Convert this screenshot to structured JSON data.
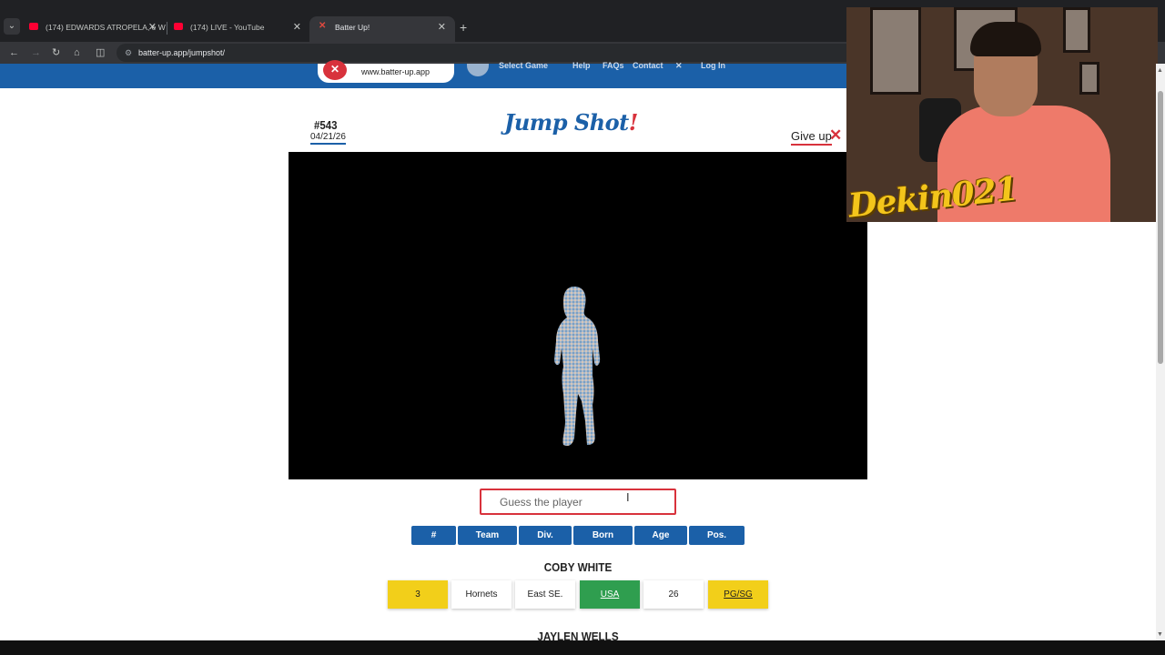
{
  "browser": {
    "tabs": [
      {
        "label": "(174) EDWARDS ATROPELA, e W",
        "favicon": "youtube-icon"
      },
      {
        "label": "(174) LIVE - YouTube",
        "favicon": "youtube-icon"
      },
      {
        "label": "Batter Up!",
        "favicon": "batter-up-icon"
      }
    ],
    "close_glyph": "✕",
    "new_tab_glyph": "+",
    "url": "batter-up.app/jumpshot/"
  },
  "site": {
    "logo_text": "www.batter-up.app",
    "nav": [
      "Select Game",
      "Help",
      "FAQs",
      "Contact",
      "Log In"
    ]
  },
  "game": {
    "puzzle_number": "#543",
    "puzzle_date": "04/21/26",
    "title": "Jump Shot",
    "title_bang": "!",
    "give_up_label": "Give up",
    "give_up_glyph": "✕",
    "guess_placeholder": "Guess the player"
  },
  "columns": [
    "#",
    "Team",
    "Div.",
    "Born",
    "Age",
    "Pos."
  ],
  "guesses": [
    {
      "name": "COBY WHITE",
      "cells": [
        {
          "value": "3",
          "status": "yellow"
        },
        {
          "value": "Hornets",
          "status": "none"
        },
        {
          "value": "East SE.",
          "status": "none"
        },
        {
          "value": "USA",
          "status": "green"
        },
        {
          "value": "26",
          "status": "none"
        },
        {
          "value": "PG/SG",
          "status": "yellow"
        }
      ]
    },
    {
      "name": "JAYLEN WELLS",
      "cells": []
    }
  ],
  "overlay": {
    "streamer_tag": "Dekin021"
  },
  "colors": {
    "brand_blue": "#1b60a8",
    "accent_red": "#d8323c",
    "match_green": "#2f9e4f",
    "partial_yellow": "#f2cf1a"
  }
}
